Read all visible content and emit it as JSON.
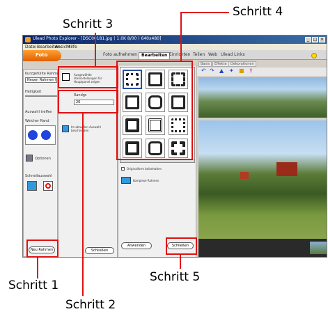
{
  "annotations": {
    "step1": "Schritt 1",
    "step2": "Schritt 2",
    "step3": "Schritt 3",
    "step4": "Schritt 4",
    "step5": "Schritt 5"
  },
  "window": {
    "title": "Ulead Photo Explorer - [DSC00181.jpg ( 1.0K 8/00 ) 640x480]"
  },
  "menu": [
    "Datei",
    "Bearbeiten",
    "Ansicht",
    "Hilfe"
  ],
  "brand_tab": "Foto",
  "tabs": [
    "Foto aufnehmen",
    "Bearbeiten",
    "Einrichten",
    "Teilen",
    "Web",
    "Ulead Links"
  ],
  "subtabs": [
    "Basis",
    "Effekte",
    "Dekorationen"
  ],
  "left_panel": {
    "label1": "Kurzgefüllte Rahmen",
    "field1": "Neuen Rahmen hinzufügen",
    "label2": "Helligkeit",
    "check1": "Auswahl treffen",
    "label3": "Weicher Rand",
    "options_label": "Optionen",
    "label4": "Schnellauswahl"
  },
  "mid_panel": {
    "option_text": "Ausgewählte Voreinstellungen für Hauptpanel zeigen",
    "paraphrase_label": "Randgr.",
    "field_value": "20",
    "text_bottom": "Im aktuellen Auswahl beschneiden"
  },
  "frames_panel": {
    "checkbox_label": "Originalform beibehalten",
    "more_label": "Komplexe Rahmen"
  },
  "buttons": {
    "new_frame": "Neu Rahmen",
    "cancel": "Schließen",
    "apply": "Anwenden",
    "close": "Schließen"
  }
}
